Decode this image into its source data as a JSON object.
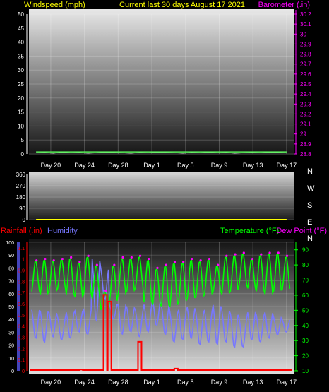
{
  "header": {
    "left_label": "Windspeed (mph)",
    "center_label": "Current last 30 days August 17 2021",
    "right_label": "Barometer (.in)"
  },
  "x_ticks": [
    "Day 20",
    "Day 24",
    "Day 28",
    "Day 1",
    "Day 5",
    "Day 9",
    "Day 13",
    "Day 17"
  ],
  "colors": {
    "background": "#000000",
    "title": "#ffff00",
    "barometer": "#ff00ff",
    "windspeed": "#ffffff",
    "rainfall": "#ff0000",
    "humidity": "#7777ff",
    "temperature": "#00ff00",
    "dewpoint": "#ff00ff",
    "wind_dir": "#ffff00"
  },
  "chart_data": [
    {
      "type": "line",
      "name": "wind_barometer",
      "ylabel": "Windspeed (mph)",
      "y2label": "Barometer (.in)",
      "ylim": [
        0,
        50
      ],
      "y_ticks": [
        "0",
        "5",
        "10",
        "15",
        "20",
        "25",
        "30",
        "35",
        "40",
        "45",
        "50"
      ],
      "y2lim": [
        28.8,
        30.2
      ],
      "y2_ticks": [
        "28.8",
        "28.9",
        "29",
        "29.1",
        "29.2",
        "29.3",
        "29.4",
        "29.5",
        "29.6",
        "29.7",
        "29.8",
        "29.9",
        "30",
        "30.1",
        "30.2"
      ],
      "series": [
        {
          "values": [
            0.4,
            0.5,
            0.3,
            0.6,
            0.4,
            0.5,
            0.3,
            0.4,
            0.6,
            0.5,
            0.4,
            0.3,
            0.5,
            0.4,
            0.6,
            0.5,
            0.4,
            0.3,
            0.5,
            0.4,
            0.6,
            0.4,
            0.5,
            0.3,
            0.4,
            0.5,
            0.4,
            0.6,
            0.5,
            0.4
          ]
        },
        {
          "values": [
            28.82,
            28.82,
            28.82,
            28.82,
            28.82,
            28.82,
            28.82,
            28.82,
            28.82,
            28.82,
            28.82,
            28.82,
            28.82,
            28.82,
            28.82,
            28.82,
            28.82,
            28.82,
            28.82,
            28.82,
            28.82,
            28.82,
            28.82,
            28.82,
            28.82,
            28.82,
            28.82,
            28.82,
            28.82,
            28.82
          ]
        }
      ]
    },
    {
      "type": "line",
      "name": "wind_direction",
      "ylim": [
        0,
        360
      ],
      "y_ticks": [
        "0",
        "90",
        "180",
        "270",
        "360"
      ],
      "direction_labels": [
        "N",
        "W",
        "S",
        "E",
        "N"
      ],
      "series": [
        {
          "values": [
            0,
            0,
            0,
            0,
            0,
            0,
            0,
            0,
            0,
            0,
            0,
            0,
            0,
            0,
            0,
            0,
            0,
            0,
            0,
            0,
            0,
            0,
            0,
            0,
            0,
            0,
            0,
            0,
            0,
            0
          ]
        }
      ]
    },
    {
      "type": "line",
      "name": "rain_humidity_temperature",
      "y_left_outer_label": "Rainfall (.in)",
      "y_left_inner_label": "Humidity",
      "y_right_label": "Temperature (°F)",
      "y_right_label2": "Dew Point (°F)",
      "rain_lim": [
        0,
        1.15
      ],
      "rain_ticks": [
        "0",
        "0.1",
        "0.2",
        "0.3",
        "0.4",
        "0.5",
        "0.6",
        "0.7",
        "0.8",
        "0.9",
        "1",
        "1.1"
      ],
      "humidity_lim": [
        0,
        100
      ],
      "humidity_ticks": [
        "0",
        "10",
        "20",
        "30",
        "40",
        "50",
        "60",
        "70",
        "80",
        "90",
        "100"
      ],
      "temp_lim": [
        10,
        95
      ],
      "temp_ticks": [
        "10",
        "20",
        "30",
        "40",
        "50",
        "60",
        "70",
        "80",
        "90"
      ],
      "rain_events": [
        {
          "day": 5.5,
          "value": 0.01
        },
        {
          "day": 8.3,
          "value": 0.68
        },
        {
          "day": 8.8,
          "value": 0.62
        },
        {
          "day": 12.3,
          "value": 0.26
        },
        {
          "day": 16.5,
          "value": 0.02
        }
      ],
      "temperature_daily": [
        {
          "low": 62,
          "high": 83
        },
        {
          "low": 60,
          "high": 84
        },
        {
          "low": 62,
          "high": 83
        },
        {
          "low": 64,
          "high": 84
        },
        {
          "low": 60,
          "high": 85
        },
        {
          "low": 58,
          "high": 82
        },
        {
          "low": 60,
          "high": 86
        },
        {
          "low": 57,
          "high": 80
        },
        {
          "low": 50,
          "high": 63
        },
        {
          "low": 55,
          "high": 80
        },
        {
          "low": 60,
          "high": 85
        },
        {
          "low": 62,
          "high": 85
        },
        {
          "low": 64,
          "high": 86
        },
        {
          "low": 55,
          "high": 84
        },
        {
          "low": 53,
          "high": 78
        },
        {
          "low": 52,
          "high": 80
        },
        {
          "low": 52,
          "high": 82
        },
        {
          "low": 55,
          "high": 82
        },
        {
          "low": 57,
          "high": 84
        },
        {
          "low": 58,
          "high": 83
        },
        {
          "low": 60,
          "high": 84
        },
        {
          "low": 62,
          "high": 80
        },
        {
          "low": 60,
          "high": 86
        },
        {
          "low": 62,
          "high": 87
        },
        {
          "low": 66,
          "high": 88
        },
        {
          "low": 64,
          "high": 84
        },
        {
          "low": 62,
          "high": 87
        },
        {
          "low": 60,
          "high": 88
        },
        {
          "low": 62,
          "high": 88
        },
        {
          "low": 63,
          "high": 86
        }
      ],
      "humidity_daily": [
        {
          "low": 25,
          "high": 48
        },
        {
          "low": 22,
          "high": 47
        },
        {
          "low": 26,
          "high": 46
        },
        {
          "low": 24,
          "high": 42
        },
        {
          "low": 25,
          "high": 46
        },
        {
          "low": 30,
          "high": 47
        },
        {
          "low": 28,
          "high": 48
        },
        {
          "low": 38,
          "high": 88
        },
        {
          "low": 55,
          "high": 80
        },
        {
          "low": 40,
          "high": 52
        },
        {
          "low": 28,
          "high": 52
        },
        {
          "low": 30,
          "high": 50
        },
        {
          "low": 26,
          "high": 48
        },
        {
          "low": 30,
          "high": 52
        },
        {
          "low": 35,
          "high": 55
        },
        {
          "low": 28,
          "high": 52
        },
        {
          "low": 22,
          "high": 46
        },
        {
          "low": 24,
          "high": 48
        },
        {
          "low": 25,
          "high": 50
        },
        {
          "low": 20,
          "high": 46
        },
        {
          "low": 22,
          "high": 48
        },
        {
          "low": 20,
          "high": 52
        },
        {
          "low": 22,
          "high": 48
        },
        {
          "low": 18,
          "high": 45
        },
        {
          "low": 18,
          "high": 42
        },
        {
          "low": 24,
          "high": 46
        },
        {
          "low": 22,
          "high": 44
        },
        {
          "low": 25,
          "high": 46
        },
        {
          "low": 28,
          "high": 42
        },
        {
          "low": 30,
          "high": 40
        }
      ]
    }
  ]
}
